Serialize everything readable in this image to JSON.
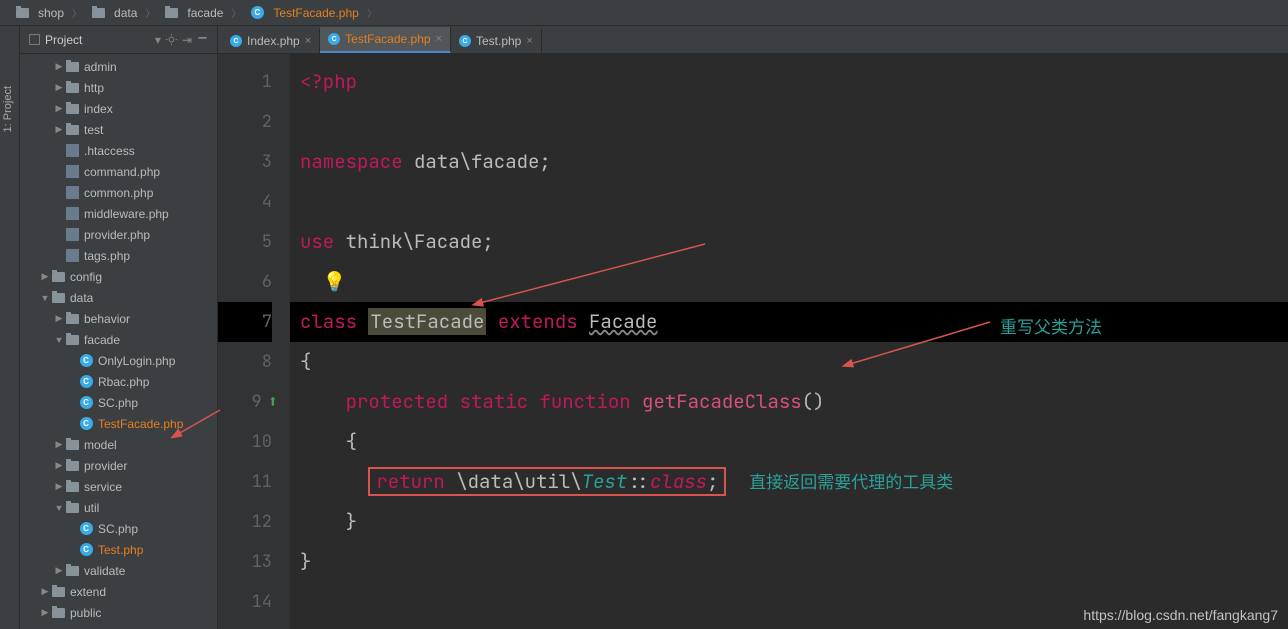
{
  "breadcrumb": [
    {
      "type": "folder",
      "label": "shop"
    },
    {
      "type": "folder",
      "label": "data"
    },
    {
      "type": "folder",
      "label": "facade"
    },
    {
      "type": "php",
      "label": "TestFacade.php",
      "active": true
    }
  ],
  "sidetab_label": "1: Project",
  "tree_header": {
    "title": "Project"
  },
  "tree": [
    {
      "depth": 2,
      "arrow": "▶",
      "icon": "folder",
      "label": "admin"
    },
    {
      "depth": 2,
      "arrow": "▶",
      "icon": "folder",
      "label": "http"
    },
    {
      "depth": 2,
      "arrow": "▶",
      "icon": "folder",
      "label": "index"
    },
    {
      "depth": 2,
      "arrow": "▶",
      "icon": "folder",
      "label": "test"
    },
    {
      "depth": 2,
      "arrow": "",
      "icon": "cfg",
      "label": ".htaccess"
    },
    {
      "depth": 2,
      "arrow": "",
      "icon": "cfg",
      "label": "command.php"
    },
    {
      "depth": 2,
      "arrow": "",
      "icon": "cfg",
      "label": "common.php"
    },
    {
      "depth": 2,
      "arrow": "",
      "icon": "cfg",
      "label": "middleware.php"
    },
    {
      "depth": 2,
      "arrow": "",
      "icon": "cfg",
      "label": "provider.php"
    },
    {
      "depth": 2,
      "arrow": "",
      "icon": "cfg",
      "label": "tags.php"
    },
    {
      "depth": 1,
      "arrow": "▶",
      "icon": "folder",
      "label": "config"
    },
    {
      "depth": 1,
      "arrow": "▼",
      "icon": "folder",
      "label": "data"
    },
    {
      "depth": 2,
      "arrow": "▶",
      "icon": "folder",
      "label": "behavior"
    },
    {
      "depth": 2,
      "arrow": "▼",
      "icon": "folder",
      "label": "facade"
    },
    {
      "depth": 3,
      "arrow": "",
      "icon": "php",
      "label": "OnlyLogin.php"
    },
    {
      "depth": 3,
      "arrow": "",
      "icon": "php",
      "label": "Rbac.php"
    },
    {
      "depth": 3,
      "arrow": "",
      "icon": "php",
      "label": "SC.php"
    },
    {
      "depth": 3,
      "arrow": "",
      "icon": "php",
      "label": "TestFacade.php",
      "sel": true
    },
    {
      "depth": 2,
      "arrow": "▶",
      "icon": "folder",
      "label": "model"
    },
    {
      "depth": 2,
      "arrow": "▶",
      "icon": "folder",
      "label": "provider"
    },
    {
      "depth": 2,
      "arrow": "▶",
      "icon": "folder",
      "label": "service"
    },
    {
      "depth": 2,
      "arrow": "▼",
      "icon": "folder",
      "label": "util"
    },
    {
      "depth": 3,
      "arrow": "",
      "icon": "php",
      "label": "SC.php"
    },
    {
      "depth": 3,
      "arrow": "",
      "icon": "php",
      "label": "Test.php",
      "sel": true
    },
    {
      "depth": 2,
      "arrow": "▶",
      "icon": "folder",
      "label": "validate"
    },
    {
      "depth": 1,
      "arrow": "▶",
      "icon": "folder",
      "label": "extend"
    },
    {
      "depth": 1,
      "arrow": "▶",
      "icon": "folder",
      "label": "public"
    }
  ],
  "tabs": [
    {
      "label": "Index.php",
      "active": false
    },
    {
      "label": "TestFacade.php",
      "active": true
    },
    {
      "label": "Test.php",
      "active": false
    }
  ],
  "code": {
    "lines": [
      1,
      2,
      3,
      4,
      5,
      6,
      7,
      8,
      9,
      10,
      11,
      12,
      13,
      14
    ],
    "highlight_line": 7,
    "l1_open": "<?php",
    "l3_ns": "namespace",
    "l3_rest": " data\\facade;",
    "l5_use": "use",
    "l5_rest": " think\\Facade;",
    "l7_class": "class ",
    "l7_name": "TestFacade",
    "l7_ext": " extends ",
    "l7_par": "Facade",
    "l8": "{",
    "l9_prot": "protected ",
    "l9_stat": "static ",
    "l9_func": "function ",
    "l9_name": "getFacadeClass",
    "l9_par": "()",
    "l10": "{",
    "l11_ret": "return ",
    "l11_path": "\\data\\util\\",
    "l11_cls": "Test",
    "l11_op": "::",
    "l11_class": "class",
    "l11_semi": ";",
    "l12": "}",
    "l13": "}"
  },
  "annotations": {
    "override": "重写父类方法",
    "return": "直接返回需要代理的工具类"
  },
  "watermark": "https://blog.csdn.net/fangkang7"
}
